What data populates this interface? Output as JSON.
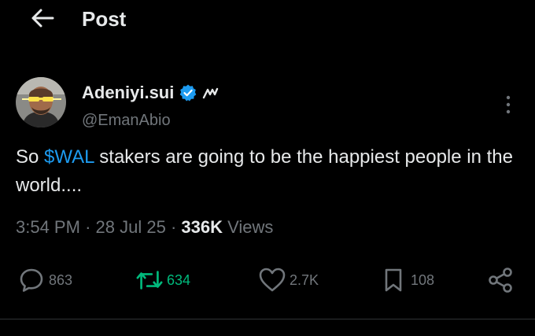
{
  "header": {
    "title": "Post",
    "back_icon": "arrow-left-icon"
  },
  "post": {
    "author": {
      "display_name": "Adeniyi.sui",
      "handle": "@EmanAbio",
      "verified": true,
      "verified_color": "#1d9bf0",
      "affiliation_icon": "mysten-affiliate-icon"
    },
    "text": {
      "before": "So ",
      "cashtag": "$WAL",
      "after": " stakers are going to be the happiest people in the world...."
    },
    "meta": {
      "time": "3:54 PM",
      "separator": "·",
      "date": "28 Jul 25",
      "views_count": "336K",
      "views_label": "Views"
    },
    "actions": {
      "replies": "863",
      "reposts": "634",
      "likes": "2.7K",
      "bookmarks": "108"
    },
    "colors": {
      "background": "#000000",
      "text": "#e7e9ea",
      "muted": "#71767b",
      "accent": "#1d9bf0",
      "repost_active": "#00ba7c"
    }
  }
}
